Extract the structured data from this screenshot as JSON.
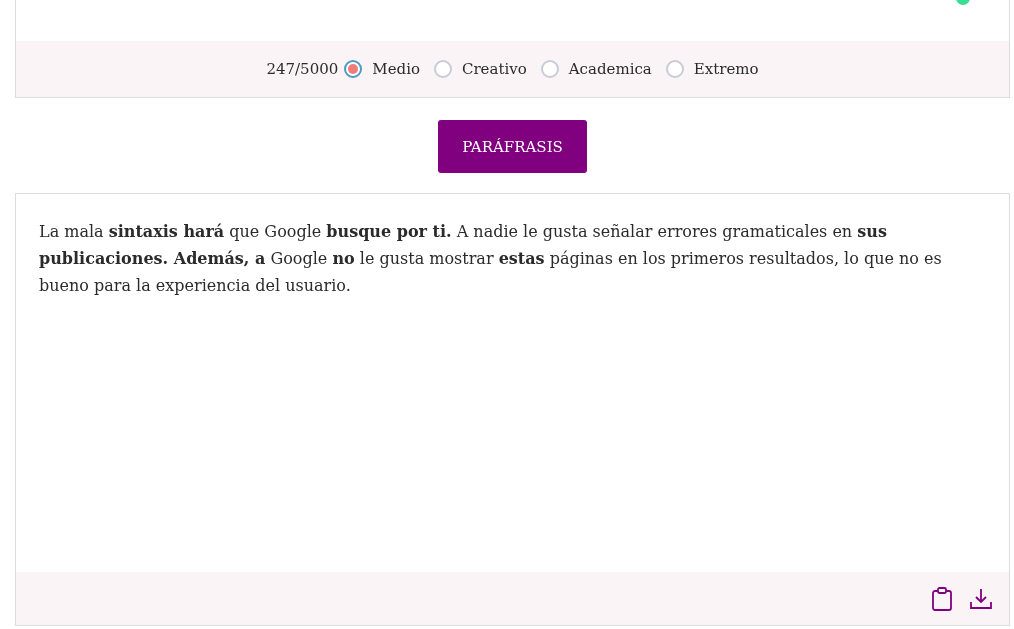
{
  "input_panel": {
    "char_count": "247/5000",
    "modes": [
      {
        "label": "Medio",
        "selected": true
      },
      {
        "label": "Creativo",
        "selected": false
      },
      {
        "label": "Academica",
        "selected": false
      },
      {
        "label": "Extremo",
        "selected": false
      }
    ]
  },
  "paraphrase_button": "PARÁFRASIS",
  "output_panel": {
    "text": "La mala **sintaxis hará** que Google **busque por ti.** A nadie le gusta señalar errores gramaticales en **sus publicaciones. Además, a** Google **no** le gusta mostrar **estas** páginas en los primeros resultados, lo que no es bueno para la experiencia del usuario."
  }
}
